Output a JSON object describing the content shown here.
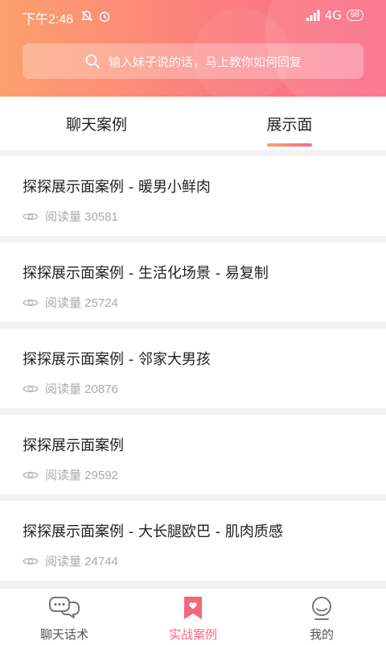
{
  "status_bar": {
    "time": "下午2:48",
    "network": "4G",
    "battery": "98"
  },
  "search": {
    "placeholder": "输入妹子说的话，马上教你如何回复"
  },
  "tabs": [
    {
      "label": "聊天案例",
      "active": false
    },
    {
      "label": "展示面",
      "active": true
    }
  ],
  "articles": [
    {
      "title": "探探展示面案例 - 暖男小鲜肉",
      "views_label": "阅读量 30581"
    },
    {
      "title": "探探展示面案例 - 生活化场景 - 易复制",
      "views_label": "阅读量 25724"
    },
    {
      "title": "探探展示面案例 - 邻家大男孩",
      "views_label": "阅读量 20876"
    },
    {
      "title": "探探展示面案例",
      "views_label": "阅读量 29592"
    },
    {
      "title": "探探展示面案例 - 大长腿欧巴 - 肌肉质感",
      "views_label": "阅读量 24744"
    }
  ],
  "bottom_nav": [
    {
      "label": "聊天话术",
      "icon": "chat-bubbles-icon",
      "active": false
    },
    {
      "label": "实战案例",
      "icon": "heart-bookmark-icon",
      "active": true
    },
    {
      "label": "我的",
      "icon": "smiley-profile-icon",
      "active": false
    }
  ],
  "colors": {
    "gradient_start": "#fda06c",
    "gradient_end": "#f96a87",
    "accent": "#f4687c"
  }
}
